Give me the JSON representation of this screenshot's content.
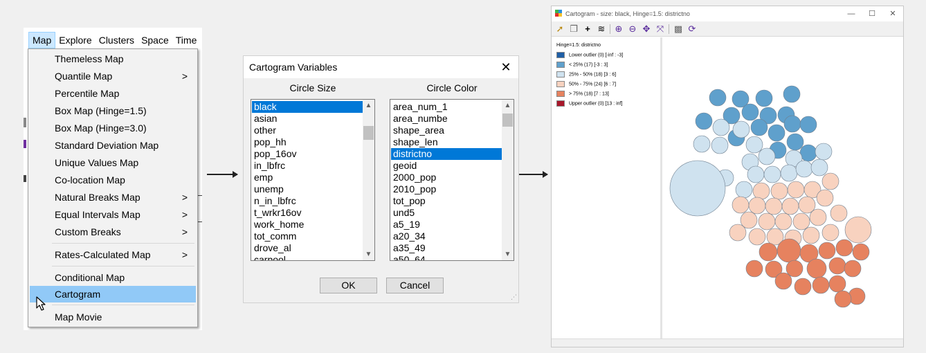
{
  "menu": {
    "menubar": [
      "Map",
      "Explore",
      "Clusters",
      "Space",
      "Time"
    ],
    "items": [
      {
        "label": "Themeless Map",
        "submenu": false
      },
      {
        "label": "Quantile Map",
        "submenu": true
      },
      {
        "label": "Percentile Map",
        "submenu": false
      },
      {
        "label": "Box Map (Hinge=1.5)",
        "submenu": false
      },
      {
        "label": "Box Map (Hinge=3.0)",
        "submenu": false
      },
      {
        "label": "Standard Deviation Map",
        "submenu": false
      },
      {
        "label": "Unique Values Map",
        "submenu": false
      },
      {
        "label": "Co-location Map",
        "submenu": false
      },
      {
        "label": "Natural Breaks Map",
        "submenu": true
      },
      {
        "label": "Equal Intervals Map",
        "submenu": true
      },
      {
        "label": "Custom Breaks",
        "submenu": true
      },
      {
        "label": "Rates-Calculated Map",
        "submenu": true
      },
      {
        "label": "Conditional Map",
        "submenu": false
      },
      {
        "label": "Cartogram",
        "submenu": false,
        "highlighted": true
      },
      {
        "label": "Map Movie",
        "submenu": false
      }
    ],
    "submenu_arrow": ">"
  },
  "dialog": {
    "title": "Cartogram Variables",
    "close": "✕",
    "size_header": "Circle Size",
    "color_header": "Circle Color",
    "size_list": [
      "black",
      "asian",
      "other",
      "pop_hh",
      "pop_16ov",
      "in_lbfrc",
      "emp",
      "unemp",
      "n_in_lbfrc",
      "t_wrkr16ov",
      "work_home",
      "tot_comm",
      "drove_al",
      "carpool"
    ],
    "size_selected": "black",
    "color_list": [
      "area_num_1",
      "area_numbe",
      "shape_area",
      "shape_len",
      "districtno",
      "geoid",
      "2000_pop",
      "2010_pop",
      "tot_pop",
      "und5",
      "a5_19",
      "a20_34",
      "a35_49",
      "a50_64"
    ],
    "color_selected": "districtno",
    "ok": "OK",
    "cancel": "Cancel",
    "scroll_up": "▲",
    "scroll_down": "▼"
  },
  "cartogram": {
    "title": "Cartogram - size: black, Hinge=1.5: districtno",
    "controls": [
      "—",
      "☐",
      "✕"
    ],
    "legend_title": "Hinge=1.5: districtno",
    "legend": [
      {
        "label": "Lower outlier (0)  [-inf : -3]",
        "color": "#1f5fa6"
      },
      {
        "label": "< 25% (17)  [-3 : 3]",
        "color": "#5fa0cc"
      },
      {
        "label": "25% - 50% (18)  [3 : 6]",
        "color": "#cfe2ef"
      },
      {
        "label": "50% - 75% (24)  [6 : 7]",
        "color": "#f8d2bf"
      },
      {
        "label": "> 75% (18)  [7 : 13]",
        "color": "#e6825f"
      },
      {
        "label": "Upper outlier (0)  [13 : inf]",
        "color": "#a8172a"
      }
    ],
    "toolbar_icons": [
      "select-icon",
      "copy-icon",
      "crosshair-icon",
      "layers-icon",
      "zoom-in-icon",
      "zoom-out-icon",
      "pan-icon",
      "fit-extent-icon",
      "reset-icon",
      "refresh-icon"
    ],
    "circle_counts": {
      "lt25": 17,
      "p25_50": 18,
      "p50_75": 24,
      "gt75": 18
    }
  },
  "colors": {
    "highlight": "#91c9f7",
    "selection": "#0078d7",
    "lt25": "#5fa0cc",
    "p25_50": "#cfe2ef",
    "p50_75": "#f8d2bf",
    "gt75": "#e6825f"
  }
}
